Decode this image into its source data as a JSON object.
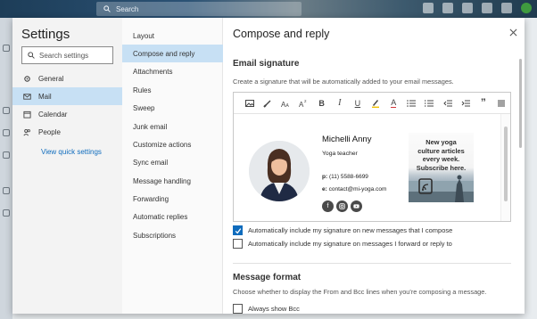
{
  "topbar": {
    "search_placeholder": "Search"
  },
  "settings": {
    "title": "Settings",
    "search_placeholder": "Search settings",
    "nav": [
      {
        "label": "General",
        "icon": "gear-icon"
      },
      {
        "label": "Mail",
        "icon": "mail-icon"
      },
      {
        "label": "Calendar",
        "icon": "calendar-icon"
      },
      {
        "label": "People",
        "icon": "people-icon"
      }
    ],
    "quick_settings_link": "View quick settings"
  },
  "mail_nav": [
    "Layout",
    "Compose and reply",
    "Attachments",
    "Rules",
    "Sweep",
    "Junk email",
    "Customize actions",
    "Sync email",
    "Message handling",
    "Forwarding",
    "Automatic replies",
    "Subscriptions"
  ],
  "content": {
    "title": "Compose and reply",
    "email_signature": {
      "heading": "Email signature",
      "description": "Create a signature that will be automatically added to your email messages."
    },
    "toolbar": {
      "bold": "B",
      "italic": "I",
      "underline": "U",
      "font_color": "A",
      "quote": "”"
    },
    "signature": {
      "name": "Michelli Anny",
      "role": "Yoga teacher",
      "phone_label": "p:",
      "phone": "(11) 5588-6699",
      "email_label": "e:",
      "email": "contact@mi-yoga.com",
      "promo_lines": [
        "New yoga",
        "culture articles",
        "every week.",
        "Subscribe here."
      ]
    },
    "checkboxes": [
      {
        "label": "Automatically include my signature on new messages that I compose",
        "checked": true
      },
      {
        "label": "Automatically include my signature on messages I forward or reply to",
        "checked": false
      }
    ],
    "message_format": {
      "heading": "Message format",
      "description": "Choose whether to display the From and Bcc lines when you're composing a message.",
      "always_show_bcc": "Always show Bcc"
    }
  },
  "colors": {
    "accent": "#0f6cbd",
    "selected_nav": "#c7e0f4"
  }
}
